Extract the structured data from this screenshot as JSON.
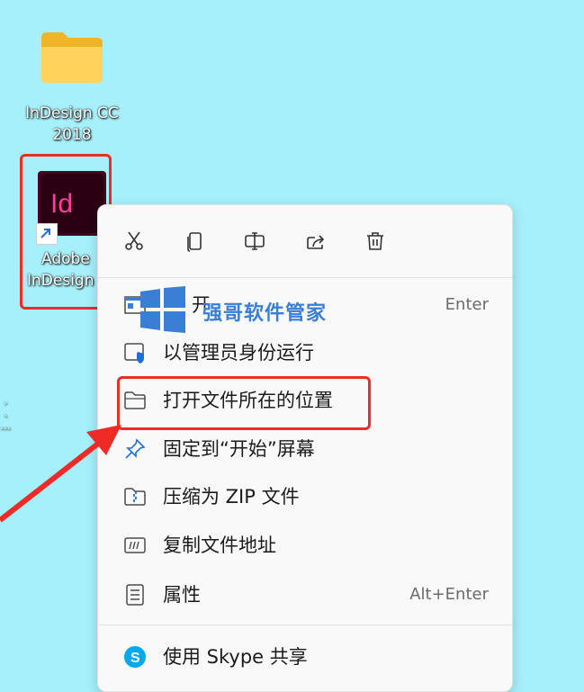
{
  "desktop": {
    "folder": {
      "label_line1": "InDesign CC",
      "label_line2": "2018",
      "icon": "folder-icon"
    },
    "shortcut": {
      "label_line1": "Adobe",
      "label_line2": "InDesign",
      "icon": "indesign-app-icon",
      "logo_text": "Id"
    },
    "stray_text": ".\n.\n..."
  },
  "context_menu": {
    "toolbar": [
      {
        "name": "cut",
        "icon": "scissors-icon"
      },
      {
        "name": "copy",
        "icon": "copy-icon"
      },
      {
        "name": "rename",
        "icon": "rename-icon"
      },
      {
        "name": "share",
        "icon": "share-icon"
      },
      {
        "name": "delete",
        "icon": "trash-icon"
      }
    ],
    "items": [
      {
        "label": "开",
        "shortcut": "Enter",
        "icon": "open-app-icon"
      },
      {
        "label": "以管理员身份运行",
        "shortcut": "",
        "icon": "shield-icon"
      },
      {
        "label": "打开文件所在的位置",
        "shortcut": "",
        "icon": "folder-outline-icon"
      },
      {
        "label": "固定到“开始”屏幕",
        "shortcut": "",
        "icon": "pin-icon"
      },
      {
        "label": "压缩为 ZIP 文件",
        "shortcut": "",
        "icon": "zip-icon"
      },
      {
        "label": "复制文件地址",
        "shortcut": "",
        "icon": "copy-path-icon"
      },
      {
        "label": "属性",
        "shortcut": "Alt+Enter",
        "icon": "properties-icon"
      },
      {
        "label": "使用 Skype 共享",
        "shortcut": "",
        "icon": "skype-icon"
      }
    ]
  },
  "watermark": {
    "text": "强哥软件管家"
  },
  "colors": {
    "background": "#a6f0fb",
    "highlight_red": "#f02a26",
    "indesign_pink": "#ff3d9a",
    "watermark_blue": "#3a7ed6"
  }
}
